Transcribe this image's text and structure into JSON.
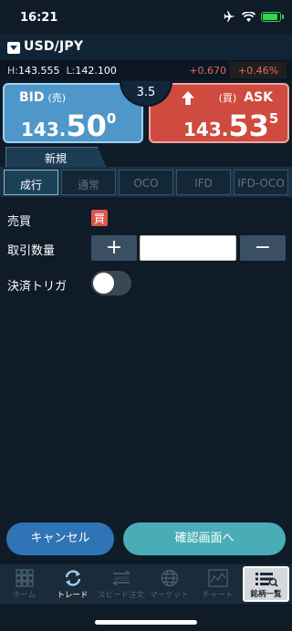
{
  "status_bar": {
    "time": "16:21",
    "icons": [
      "airplane-icon",
      "wifi-icon",
      "battery-charging-icon"
    ],
    "battery_level": 0.8
  },
  "header": {
    "pair": "USD/JPY"
  },
  "range": {
    "high_label": "H:",
    "high": "143.555",
    "low_label": "L:",
    "low": "142.100",
    "change": "+0.670",
    "change_pct": "+0.46%"
  },
  "bid": {
    "label": "BID",
    "kana": "(売)",
    "price_small": "143.",
    "price_big": "50",
    "price_sup": "0"
  },
  "ask": {
    "label": "ASK",
    "kana": "(買)",
    "price_small": "143.",
    "price_big": "53",
    "price_sup": "5"
  },
  "spread": "3.5",
  "order_tab": "新規",
  "order_types": [
    {
      "label": "成行",
      "active": true
    },
    {
      "label": "通常",
      "active": false
    },
    {
      "label": "OCO",
      "active": false
    },
    {
      "label": "IFD",
      "active": false
    },
    {
      "label": "IFD-OCO",
      "active": false
    }
  ],
  "form": {
    "side_label": "売買",
    "side_value": "買",
    "qty_label": "取引数量",
    "qty_plus": "+",
    "qty_minus": "−",
    "qty_value": "",
    "trigger_label": "決済トリガ",
    "trigger_on": false
  },
  "buttons": {
    "cancel": "キャンセル",
    "confirm": "確認画面へ"
  },
  "nav": [
    {
      "label": "ホーム",
      "icon": "grid-icon"
    },
    {
      "label": "トレード",
      "icon": "refresh-arrows-icon",
      "active": true
    },
    {
      "label": "スピード注文",
      "icon": "speed-arrows-icon"
    },
    {
      "label": "マーケット",
      "icon": "globe-icon"
    },
    {
      "label": "チャート",
      "icon": "chart-icon"
    },
    {
      "label": "銘柄一覧",
      "icon": "list-icon"
    }
  ],
  "colors": {
    "bid": "#4f97c9",
    "ask": "#cf4b3f",
    "background": "#0f1b27",
    "confirm": "#49adb7",
    "cancel": "#2f74b5"
  }
}
